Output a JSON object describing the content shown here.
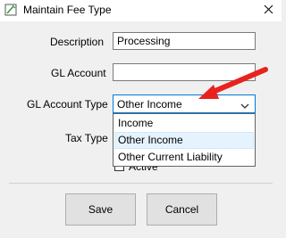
{
  "window": {
    "title": "Maintain Fee Type",
    "close_glyph": "✕"
  },
  "form": {
    "description_label": "Description",
    "description_value": "Processing",
    "gl_account_label": "GL Account",
    "gl_account_value": "",
    "gl_account_type_label": "GL Account Type",
    "gl_account_type_value": "Other Income",
    "gl_account_type_options": [
      "Income",
      "Other Income",
      "Other Current Liability"
    ],
    "tax_type_label": "Tax Type",
    "active_label": "Active"
  },
  "buttons": {
    "save_label": "Save",
    "cancel_label": "Cancel"
  },
  "colors": {
    "annotation_arrow": "#e8231d",
    "focus_border": "#0078d7",
    "selected_item": "#e5f3ff"
  }
}
